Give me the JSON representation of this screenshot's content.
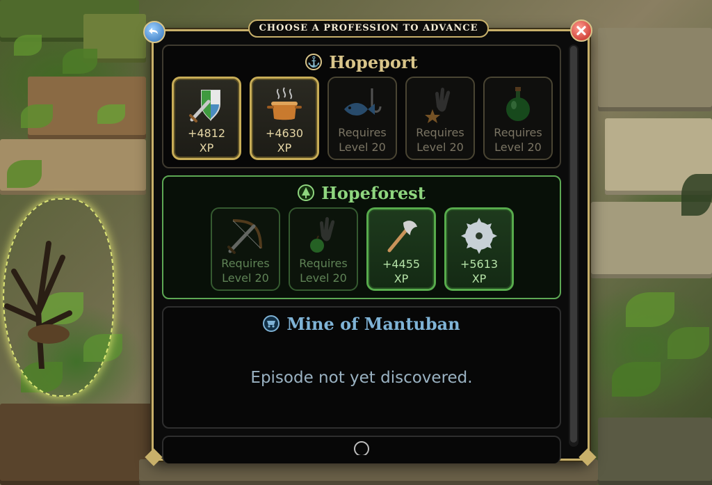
{
  "dialog": {
    "title": "CHOOSE A PROFESSION TO ADVANCE",
    "back_icon": "back-arrow-icon",
    "close_icon": "close-x-icon"
  },
  "sections": {
    "hopeport": {
      "name": "Hopeport",
      "icon": "anchor-icon",
      "accent": "#d9c58a",
      "cards": [
        {
          "icon": "shield-sword-icon",
          "line1": "+4812",
          "line2": "XP",
          "state": "active"
        },
        {
          "icon": "cooking-pot-icon",
          "line1": "+4630",
          "line2": "XP",
          "state": "active"
        },
        {
          "icon": "fish-hook-icon",
          "line1": "Requires",
          "line2": "Level 20",
          "state": "locked"
        },
        {
          "icon": "glove-star-icon",
          "line1": "Requires",
          "line2": "Level 20",
          "state": "locked"
        },
        {
          "icon": "potion-flask-icon",
          "line1": "Requires",
          "line2": "Level 20",
          "state": "locked"
        }
      ]
    },
    "hopeforest": {
      "name": "Hopeforest",
      "icon": "pine-tree-icon",
      "accent": "#8fd67f",
      "cards": [
        {
          "icon": "bow-sword-icon",
          "line1": "Requires",
          "line2": "Level 20",
          "state": "locked"
        },
        {
          "icon": "glove-apple-icon",
          "line1": "Requires",
          "line2": "Level 20",
          "state": "locked"
        },
        {
          "icon": "axe-icon",
          "line1": "+4455",
          "line2": "XP",
          "state": "active"
        },
        {
          "icon": "saw-blade-icon",
          "line1": "+5613",
          "line2": "XP",
          "state": "active"
        }
      ]
    },
    "mine": {
      "name": "Mine of Mantuban",
      "icon": "minecart-icon",
      "accent": "#7fb3d6",
      "message": "Episode not yet discovered."
    }
  }
}
